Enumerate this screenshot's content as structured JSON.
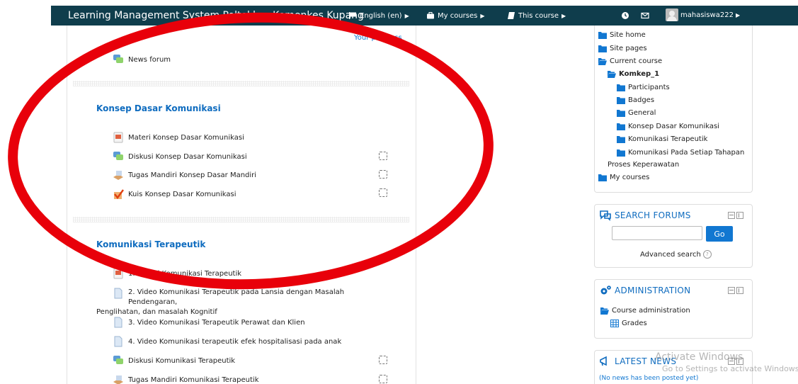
{
  "topbar": {
    "site_title": "Learning Management System Poltekkes Kemenkes Kupang",
    "language": "English (en)",
    "my_courses": "My courses",
    "this_course": "This course",
    "username": "mahasiswa222"
  },
  "main": {
    "progress_link": "Your progress",
    "news_forum": "News forum",
    "section1": {
      "title": "Konsep Dasar Komunikasi",
      "items": [
        {
          "label": "Materi Konsep Dasar Komunikasi",
          "icon": "pdf-icon"
        },
        {
          "label": "Diskusi Konsep Dasar Komunikasi",
          "icon": "forum-icon"
        },
        {
          "label": "Tugas Mandiri Konsep Dasar Mandiri",
          "icon": "assignment-icon"
        },
        {
          "label": "Kuis Konsep Dasar Komunikasi",
          "icon": "quiz-icon"
        }
      ]
    },
    "section2": {
      "title": "Komunikasi Terapeutik",
      "items": [
        {
          "label": "1. Materi Komunikasi Terapeutik",
          "icon": "pdf-icon"
        },
        {
          "label": "2. Video Komunikasi Terapeutik pada Lansia dengan Masalah Pendengaran,",
          "label2": "Penglihatan, dan masalah Kognitif",
          "icon": "file-icon"
        },
        {
          "label": "3. Video Komunikasi Terapeutik Perawat dan Klien",
          "icon": "file-icon"
        },
        {
          "label": "4. Video Komunikasi terapeutik efek hospitalisasi pada anak",
          "icon": "file-icon"
        },
        {
          "label": "Diskusi Komunikasi Terapeutik",
          "icon": "forum-icon"
        },
        {
          "label": "Tugas Mandiri Komunikasi Terapeutik",
          "icon": "assignment-icon"
        }
      ]
    }
  },
  "navigation": {
    "site_home": "Site home",
    "site_pages": "Site pages",
    "current_course": "Current course",
    "course": "Komkep_1",
    "participants": "Participants",
    "badges": "Badges",
    "general": "General",
    "section1": "Konsep Dasar Komunikasi",
    "section2": "Komunikasi Terapeutik",
    "section3_line1": "Komunikasi Pada Setiap Tahapan",
    "section3_line2": "Proses Keperawatan",
    "my_courses": "My courses"
  },
  "search_forums": {
    "title": "SEARCH FORUMS",
    "go": "Go",
    "advanced": "Advanced search"
  },
  "administration": {
    "title": "ADMINISTRATION",
    "course_admin": "Course administration",
    "grades": "Grades"
  },
  "latest_news": {
    "title": "LATEST NEWS",
    "empty": "(No news has been posted yet)"
  },
  "watermark": {
    "line1": "Activate Windows",
    "line2": "Go to Settings to activate Windows."
  },
  "colors": {
    "topbar": "#0f3d4c",
    "link": "#1177d1",
    "annotation": "#e8000a"
  }
}
